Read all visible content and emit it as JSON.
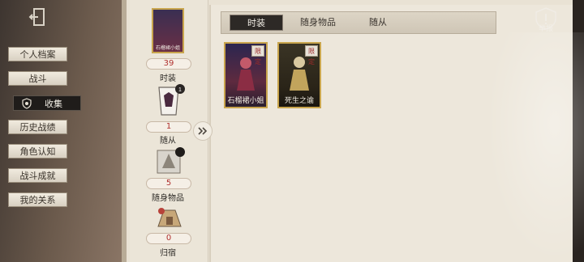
{
  "nav": {
    "items": [
      {
        "label": "个人档案"
      },
      {
        "label": "战斗"
      },
      {
        "label": "收集"
      },
      {
        "label": "历史战绩"
      },
      {
        "label": "角色认知"
      },
      {
        "label": "战斗成就"
      },
      {
        "label": "我的关系"
      }
    ],
    "active_index": 2
  },
  "stats": [
    {
      "label": "时装",
      "count": "39",
      "card_caption": "石榴裙小姐"
    },
    {
      "label": "随从",
      "count": "1",
      "card_caption": ""
    },
    {
      "label": "随身物品",
      "count": "5",
      "card_caption": ""
    },
    {
      "label": "归宿",
      "count": "0",
      "card_caption": ""
    }
  ],
  "tabs": [
    {
      "label": "时装"
    },
    {
      "label": "随身物品"
    },
    {
      "label": "随从"
    }
  ],
  "active_tab": 0,
  "report": {
    "label": "举报"
  },
  "items": [
    {
      "name": "石榴裙小姐",
      "badge": "限定"
    },
    {
      "name": "死生之谕",
      "badge": "限定"
    }
  ],
  "colors": {
    "accent_gold": "#c9a54d",
    "badge_red": "#9c2b2a",
    "tab_active_bg": "#2d2926",
    "counter_text": "#b0312f"
  },
  "icons": {
    "exit": "exit-door-icon",
    "shield": "shield-icon",
    "report": "report-warning-icon",
    "expand": "double-chevron-right-icon"
  }
}
